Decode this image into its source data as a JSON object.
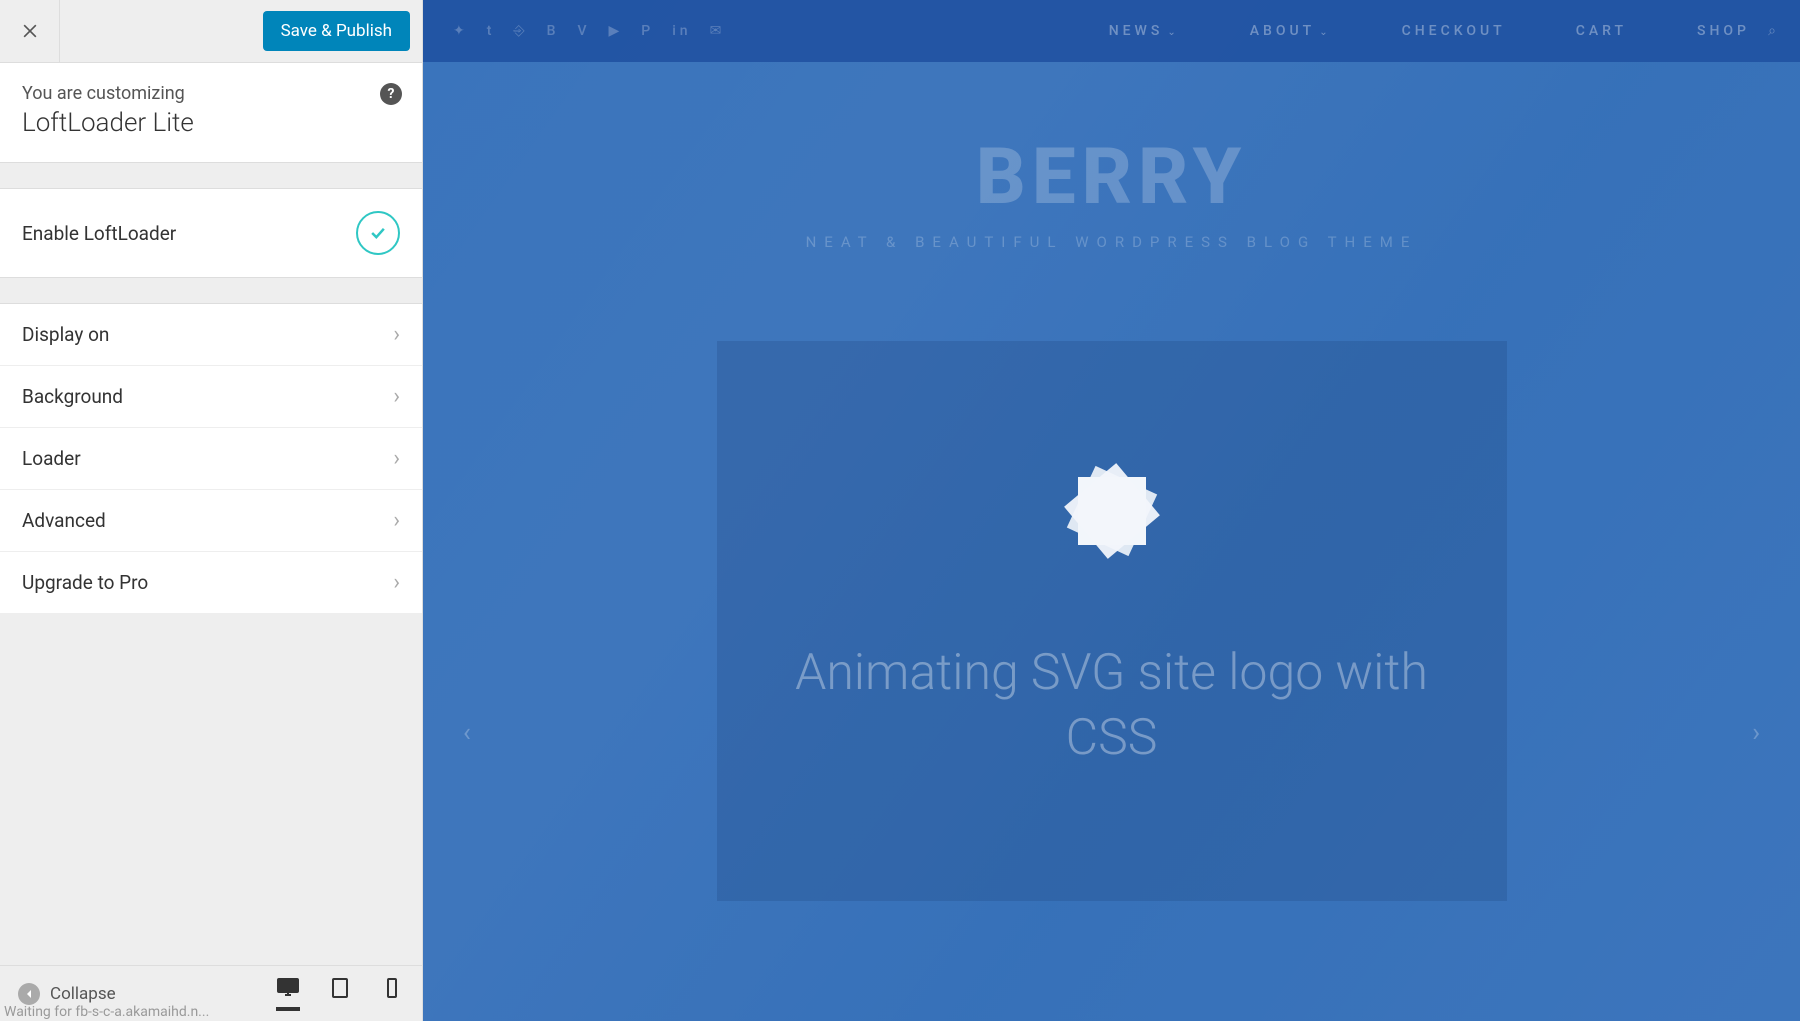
{
  "customizer": {
    "save_label": "Save & Publish",
    "info_sub": "You are customizing",
    "info_title": "LoftLoader Lite",
    "toggle_label": "Enable LoftLoader",
    "nav_items": [
      {
        "label": "Display on"
      },
      {
        "label": "Background"
      },
      {
        "label": "Loader"
      },
      {
        "label": "Advanced"
      },
      {
        "label": "Upgrade to Pro"
      }
    ],
    "collapse_label": "Collapse",
    "status_text": "Waiting for fb-s-c-a.akamaihd.n..."
  },
  "preview": {
    "nav": {
      "news": "NEWS",
      "about": "ABOUT",
      "checkout": "CHECKOUT",
      "cart": "CART",
      "shop": "SHOP"
    },
    "hero_title": "BERRY",
    "hero_sub": "NEAT & BEAUTIFUL WORDPRESS BLOG THEME",
    "feature_title": "Animating SVG site logo with CSS"
  },
  "colors": {
    "primary_button": "#0085ba",
    "accent_toggle": "#2fc7c4",
    "overlay": "#2868b8"
  }
}
